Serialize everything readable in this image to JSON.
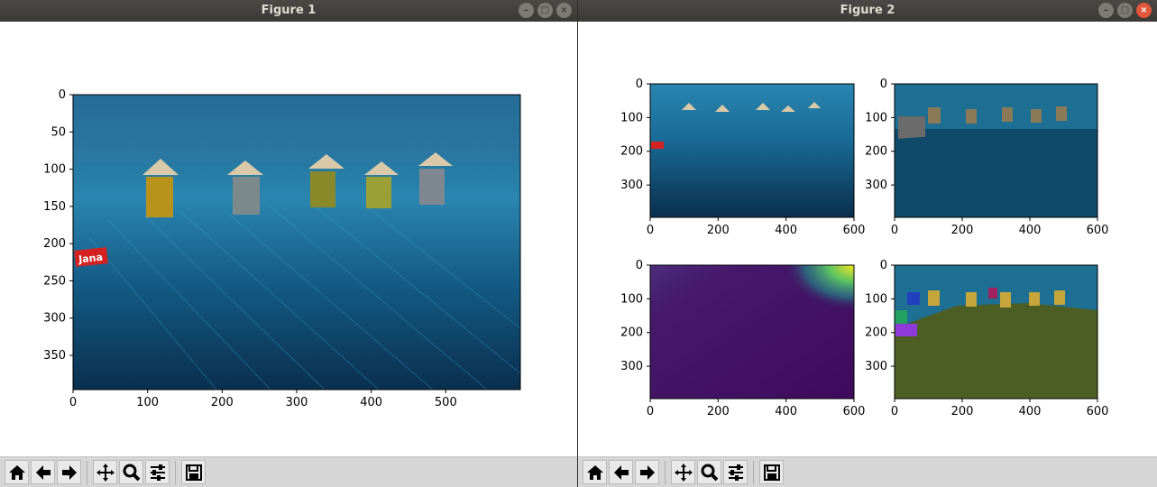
{
  "windows": [
    {
      "title": "Figure 1",
      "axes": [
        {
          "xticks": [
            "0",
            "100",
            "200",
            "300",
            "400",
            "500"
          ],
          "yticks": [
            "0",
            "50",
            "100",
            "150",
            "200",
            "250",
            "300",
            "350"
          ]
        }
      ]
    },
    {
      "title": "Figure 2",
      "axes": [
        {
          "xticks": [
            "0",
            "200",
            "400",
            "600"
          ],
          "yticks": [
            "0",
            "100",
            "200",
            "300"
          ]
        },
        {
          "xticks": [
            "0",
            "200",
            "400",
            "600"
          ],
          "yticks": [
            "0",
            "100",
            "200",
            "300"
          ]
        },
        {
          "xticks": [
            "0",
            "200",
            "400",
            "600"
          ],
          "yticks": [
            "0",
            "100",
            "200",
            "300"
          ]
        },
        {
          "xticks": [
            "0",
            "200",
            "400",
            "600"
          ],
          "yticks": [
            "0",
            "100",
            "200",
            "300"
          ]
        }
      ]
    }
  ],
  "watermark_text": "Jana",
  "window_buttons": {
    "minimize": "–",
    "maximize": "□",
    "close": "×"
  },
  "toolbar_icons": [
    "home-icon",
    "back-icon",
    "forward-icon",
    "pan-icon",
    "zoom-icon",
    "configure-subplots-icon",
    "save-icon"
  ],
  "colors": {
    "titlebar": "#3c3b37",
    "toolbar": "#d6d6d6",
    "close_active": "#e2573a"
  }
}
